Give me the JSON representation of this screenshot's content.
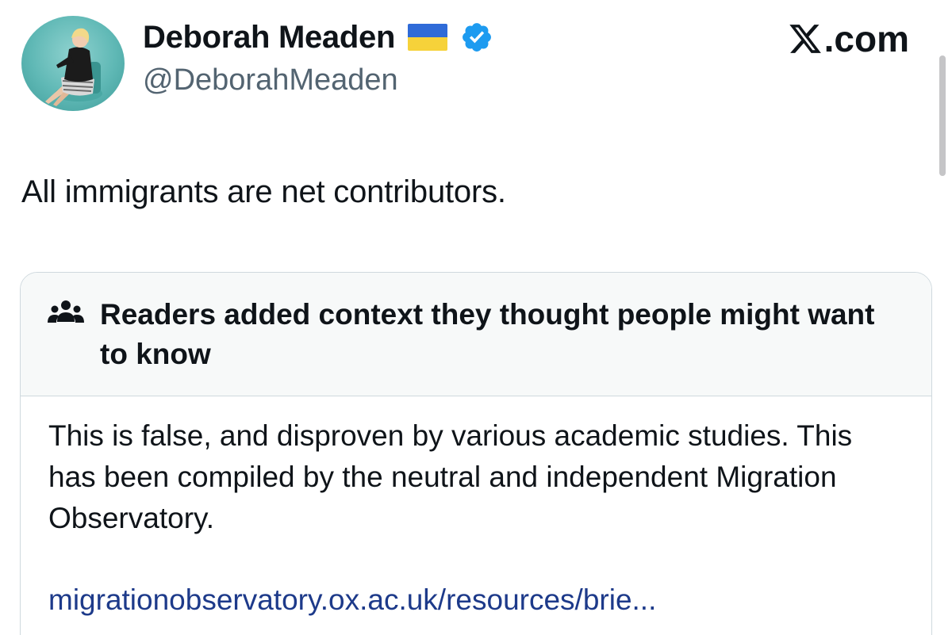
{
  "author": {
    "display_name": "Deborah Meaden",
    "handle": "@DeborahMeaden",
    "flag_icon": "ukraine-flag-icon",
    "verified_icon": "verified-badge-icon",
    "verified_color": "#1d9bf0"
  },
  "brand": {
    "label": ".com",
    "icon": "x-logo-icon"
  },
  "tweet": {
    "text": "All immigrants are net contributors."
  },
  "community_note": {
    "icon": "people-group-icon",
    "title": "Readers added context they thought people might want to know",
    "body": "This is false, and disproven by various academic studies. This has been compiled by the neutral and independent Migration Observatory.",
    "link": "migrationobservatory.ox.ac.uk/resources/brie..."
  },
  "colors": {
    "text": "#0f1419",
    "secondary_text": "#536471",
    "link": "#1d3a8a",
    "note_header_bg": "#f7f9f9",
    "border": "#cfd9de",
    "flag_blue": "#2f6bd8",
    "flag_yellow": "#f6d23a"
  }
}
